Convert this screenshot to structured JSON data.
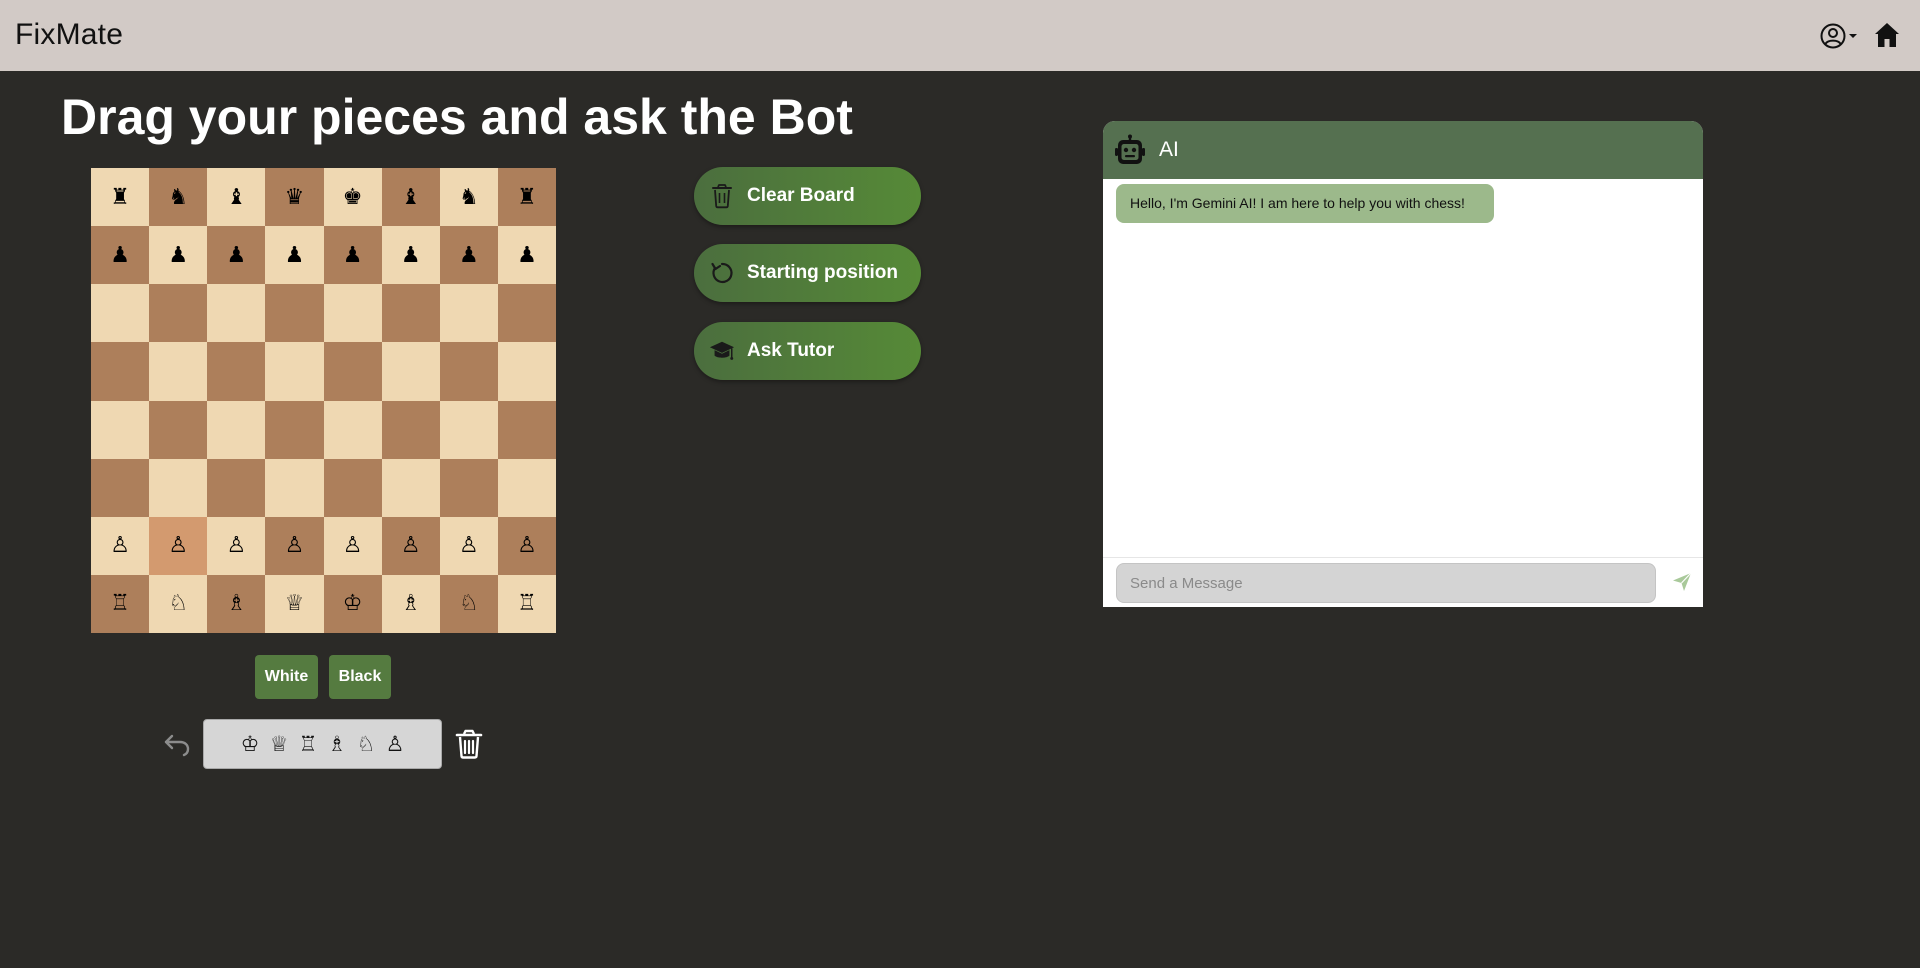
{
  "app": {
    "brand": "FixMate"
  },
  "page": {
    "title": "Drag your pieces and ask the Bot"
  },
  "board": {
    "rows": [
      [
        "♜",
        "♞",
        "♝",
        "♛",
        "♚",
        "♝",
        "♞",
        "♜"
      ],
      [
        "♟",
        "♟",
        "♟",
        "♟",
        "♟",
        "♟",
        "♟",
        "♟"
      ],
      [
        "",
        "",
        "",
        "",
        "",
        "",
        "",
        ""
      ],
      [
        "",
        "",
        "",
        "",
        "",
        "",
        "",
        ""
      ],
      [
        "",
        "",
        "",
        "",
        "",
        "",
        "",
        ""
      ],
      [
        "",
        "",
        "",
        "",
        "",
        "",
        "",
        ""
      ],
      [
        "♙",
        "♙",
        "♙",
        "♙",
        "♙",
        "♙",
        "♙",
        "♙"
      ],
      [
        "♖",
        "♘",
        "♗",
        "♕",
        "♔",
        "♗",
        "♘",
        "♖"
      ]
    ],
    "highlighted_square": "b2"
  },
  "side_buttons": {
    "white": "White",
    "black": "Black"
  },
  "spare_pieces": [
    "♔",
    "♕",
    "♖",
    "♗",
    "♘",
    "♙"
  ],
  "actions": {
    "clear_board": "Clear Board",
    "starting_position": "Starting position",
    "ask_tutor": "Ask Tutor"
  },
  "chat": {
    "header_title": "AI",
    "messages": [
      {
        "sender": "ai",
        "text": "Hello, I'm Gemini AI! I am here to help you with chess!"
      }
    ],
    "input": {
      "placeholder": "Send a Message",
      "value": ""
    }
  },
  "icons": {
    "user": "user-circle-icon",
    "home": "home-icon",
    "undo": "undo-icon",
    "trash": "trash-icon",
    "rotate": "rotate-icon",
    "graduation_cap": "graduation-cap-icon",
    "robot": "robot-icon",
    "send": "send-icon"
  },
  "colors": {
    "background": "#2b2a27",
    "topbar": "#d2cac6",
    "light_square": "#efd8b2",
    "dark_square": "#ad7f5b",
    "highlight_square": "#d39a6f",
    "accent_green": "#557b40",
    "chat_header": "#557050",
    "bubble": "#9cb98b"
  }
}
